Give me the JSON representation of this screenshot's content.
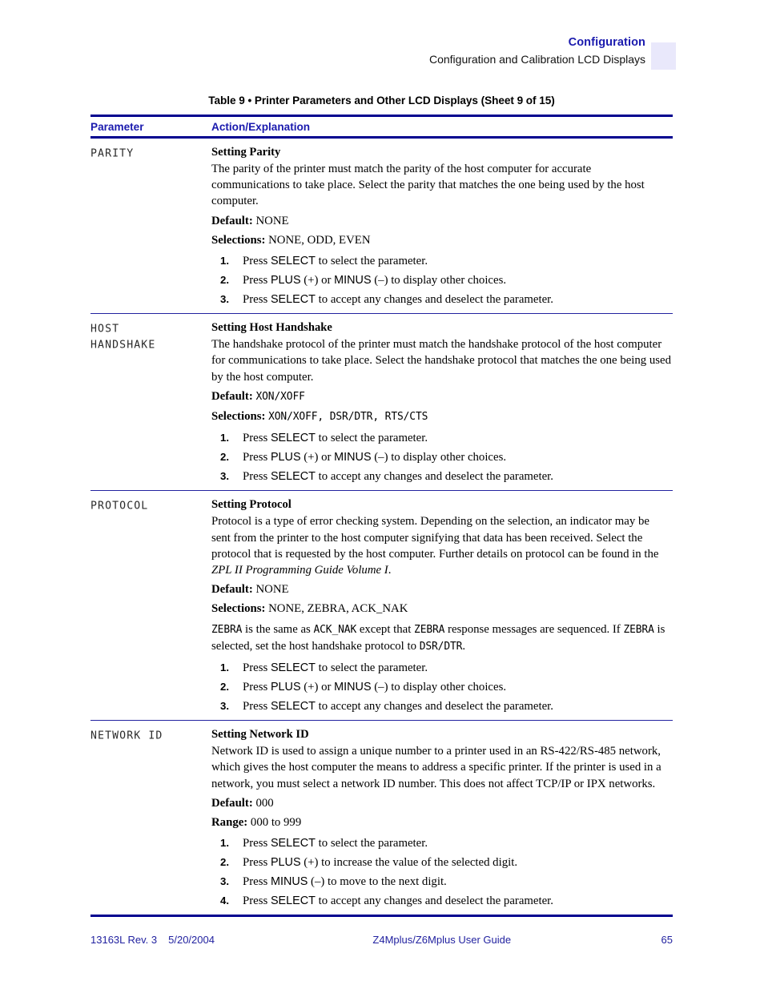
{
  "header": {
    "chapter": "Configuration",
    "section": "Configuration and Calibration LCD Displays"
  },
  "table": {
    "caption": "Table 9 • Printer Parameters and Other LCD Displays (Sheet 9 of 15)",
    "columns": {
      "parameter": "Parameter",
      "action": "Action/Explanation"
    },
    "rows": [
      {
        "parameter": "PARITY",
        "subhead": "Setting Parity",
        "body": "The parity of the printer must match the parity of the host computer for accurate communications to take place. Select the parity that matches the one being used by the host computer.",
        "default_label": "Default:",
        "default_value": "NONE",
        "selections_label": "Selections:",
        "selections_value": "NONE, ODD, EVEN",
        "steps": [
          {
            "n": "1.",
            "pre": "Press ",
            "key": "SELECT",
            "post": " to select the parameter."
          },
          {
            "n": "2.",
            "pre": "Press ",
            "key": "PLUS",
            "mid": " (+) or ",
            "key2": "MINUS",
            "post": " (–) to display other choices."
          },
          {
            "n": "3.",
            "pre": "Press ",
            "key": "SELECT",
            "post": " to accept any changes and deselect the parameter."
          }
        ]
      },
      {
        "parameter": "HOST\nHANDSHAKE",
        "subhead": "Setting Host Handshake",
        "body": "The handshake protocol of the printer must match the handshake protocol of the host computer for communications to take place. Select the handshake protocol that matches the one being used by the host computer.",
        "default_label": "Default:",
        "default_value": "XON/XOFF",
        "default_mono": true,
        "selections_label": "Selections:",
        "selections_value": "XON/XOFF, DSR/DTR, RTS/CTS",
        "selections_mono": true,
        "steps": [
          {
            "n": "1.",
            "pre": "Press ",
            "key": "SELECT",
            "post": " to select the parameter."
          },
          {
            "n": "2.",
            "pre": "Press ",
            "key": "PLUS",
            "mid": " (+) or ",
            "key2": "MINUS",
            "post": " (–) to display other choices."
          },
          {
            "n": "3.",
            "pre": "Press ",
            "key": "SELECT",
            "post": " to accept any changes and deselect the parameter."
          }
        ]
      },
      {
        "parameter": "PROTOCOL",
        "subhead": "Setting Protocol",
        "body_pre": "Protocol is a type of error checking system. Depending on the selection, an indicator may be sent from the printer to the host computer signifying that data has been received. Select the protocol that is requested by the host computer. Further details on protocol can be found in the ",
        "body_italic": "ZPL II Programming Guide Volume I",
        "body_post": ".",
        "default_label": "Default:",
        "default_value": "NONE",
        "selections_label": "Selections:",
        "selections_value": "NONE, ZEBRA, ACK_NAK",
        "note": {
          "m1": "ZEBRA",
          "t1": " is the same as ",
          "m2": "ACK_NAK",
          "t2": " except that ",
          "m3": "ZEBRA",
          "t3": " response messages are sequenced. If ",
          "m4": "ZEBRA",
          "t4": " is selected, set the host handshake protocol to ",
          "m5": "DSR/DTR",
          "t5": "."
        },
        "steps": [
          {
            "n": "1.",
            "pre": "Press ",
            "key": "SELECT",
            "post": " to select the parameter."
          },
          {
            "n": "2.",
            "pre": "Press ",
            "key": "PLUS",
            "mid": " (+) or ",
            "key2": "MINUS",
            "post": " (–) to display other choices."
          },
          {
            "n": "3.",
            "pre": "Press ",
            "key": "SELECT",
            "post": " to accept any changes and deselect the parameter."
          }
        ]
      },
      {
        "parameter": "NETWORK ID",
        "subhead": "Setting Network ID",
        "body": "Network ID is used to assign a unique number to a printer used in an RS-422/RS-485 network, which gives the host computer the means to address a specific printer. If the printer is used in a network, you must select a network ID number. This does not affect TCP/IP or IPX networks.",
        "default_label": "Default:",
        "default_value": "000",
        "selections_label": "Range:",
        "selections_value": "000 to 999",
        "steps": [
          {
            "n": "1.",
            "pre": "Press ",
            "key": "SELECT",
            "post": " to select the parameter."
          },
          {
            "n": "2.",
            "pre": "Press ",
            "key": "PLUS",
            "post": " (+) to increase the value of the selected digit."
          },
          {
            "n": "3.",
            "pre": "Press ",
            "key": "MINUS",
            "post": " (–) to move to the next digit."
          },
          {
            "n": "4.",
            "pre": "Press ",
            "key": "SELECT",
            "post": " to accept any changes and deselect the parameter."
          }
        ]
      }
    ]
  },
  "footer": {
    "doc_number": "13163L Rev. 3",
    "date": "5/20/2004",
    "title": "Z4Mplus/Z6Mplus User Guide",
    "page": "65"
  },
  "colors": {
    "rule": "#00008f",
    "heading": "#1a1aae",
    "footer": "#2222a0",
    "tab": "#e9e8fb"
  }
}
